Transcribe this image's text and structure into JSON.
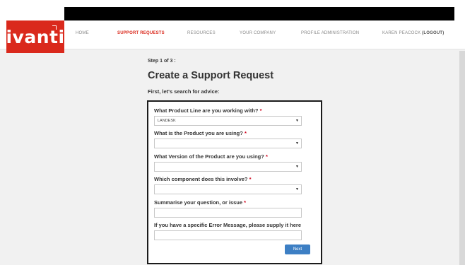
{
  "brand": {
    "logo_text": "ivanti",
    "accent_color": "#da291c"
  },
  "nav": {
    "items": [
      "HOME",
      "SUPPORT REQUESTS",
      "RESOURCES",
      "YOUR COMPANY",
      "PROFILE ADMINISTRATION"
    ],
    "active": "SUPPORT REQUESTS",
    "user_name": "KAREN PEACOCK",
    "logout_label": "(LOGOUT)"
  },
  "page": {
    "step": "Step 1 of 3 :",
    "title": "Create a Support Request",
    "subtitle": "First, let's search for advice:"
  },
  "form": {
    "product_line_label": "What Product Line are you working with?",
    "product_line_value": "LANDESK",
    "product_label": "What is the Product you are using?",
    "product_value": "",
    "version_label": "What Version of the Product are you using?",
    "version_value": "",
    "component_label": "Which component does this involve?",
    "component_value": "",
    "question_label": "Summarise your question, or issue",
    "question_value": "",
    "error_label": "If you have a specific Error Message, please supply it here",
    "error_value": "",
    "required_marker": "*",
    "dropdown_icon": "caret-down-icon",
    "next_label": "Next"
  }
}
